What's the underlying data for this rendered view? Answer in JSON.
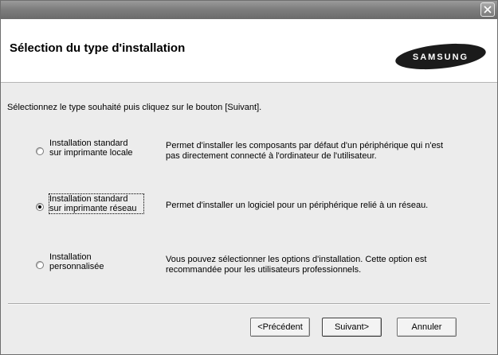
{
  "window": {
    "close_icon": "close-icon"
  },
  "header": {
    "title": "Sélection du type d'installation",
    "logo_text": "SAMSUNG"
  },
  "main": {
    "instruction": "Sélectionnez le type souhaité puis cliquez sur le bouton [Suivant].",
    "options": [
      {
        "label_line1": "Installation standard",
        "label_line2": "sur imprimante locale",
        "description_line1": "Permet d'installer les composants par défaut d'un périphérique qui n'est",
        "description_line2": "pas directement connecté à l'ordinateur de l'utilisateur.",
        "selected": false
      },
      {
        "label_line1": "Installation standard",
        "label_line2": "sur imprimante réseau",
        "description_line1": "Permet d'installer un logiciel pour un périphérique relié à un réseau.",
        "description_line2": "",
        "selected": true
      },
      {
        "label_line1": "Installation",
        "label_line2": "personnalisée",
        "description_line1": "Vous pouvez sélectionner les options d'installation. Cette option est",
        "description_line2": "recommandée pour les utilisateurs professionnels.",
        "selected": false
      }
    ]
  },
  "footer": {
    "back_label": "<Précédent",
    "next_label": "Suivant>",
    "cancel_label": "Annuler"
  }
}
